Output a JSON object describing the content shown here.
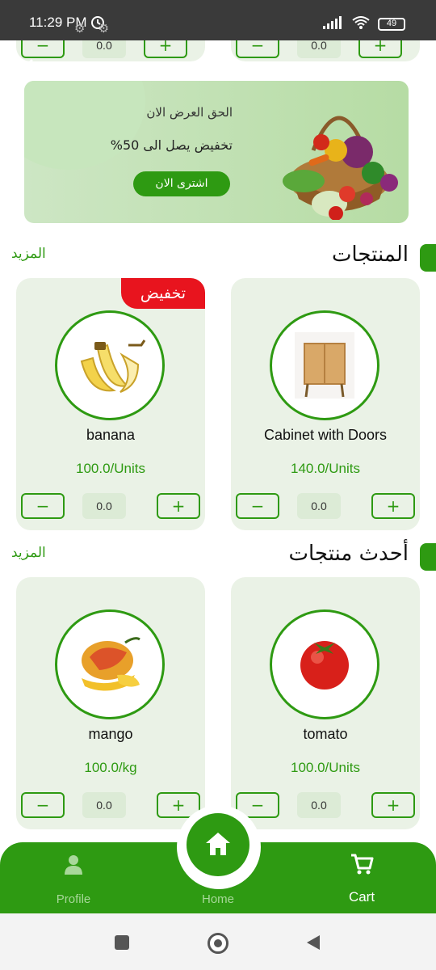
{
  "status_bar": {
    "time": "11:29 PM",
    "battery": "49"
  },
  "banner": {
    "line1": "الحق العرض الان",
    "line2": "تخفيض يصل الى 50%",
    "button": "اشترى الان"
  },
  "top_row": {
    "left_qty": "0.0",
    "right_qty": "0.0"
  },
  "products_section": {
    "title": "المنتجات",
    "more": "المزيد",
    "items": [
      {
        "name": "banana",
        "price": "100.0/Units",
        "qty": "0.0",
        "badge": "تخفيض",
        "icon": "banana-image"
      },
      {
        "name": "Cabinet with Doors",
        "price": "140.0/Units",
        "qty": "0.0",
        "icon": "cabinet-image"
      }
    ]
  },
  "latest_section": {
    "title": "أحدث منتجات",
    "more": "المزيد",
    "items": [
      {
        "name": "mango",
        "price": "100.0/kg",
        "qty": "0.0",
        "icon": "mango-image"
      },
      {
        "name": "tomato",
        "price": "100.0/Units",
        "qty": "0.0",
        "icon": "tomato-image"
      }
    ]
  },
  "qty_controls": {
    "minus": "−",
    "plus": "+"
  },
  "bottom_nav": {
    "profile": "Profile",
    "home": "Home",
    "cart": "Cart"
  },
  "colors": {
    "accent": "#2e9a12",
    "card_bg": "#eaf2e6",
    "badge": "#e8141e"
  }
}
